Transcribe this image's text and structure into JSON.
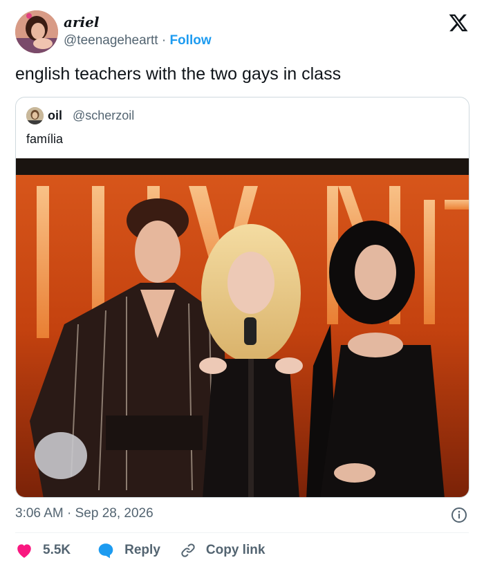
{
  "author": {
    "name": "ariel",
    "handle": "@teenageheartt",
    "separator": "·",
    "follow_label": "Follow"
  },
  "tweet": {
    "text": "english teachers with the two gays in class"
  },
  "quoted": {
    "name": "oil",
    "handle": "@scherzoil",
    "text": "família"
  },
  "meta": {
    "time": "3:06 AM",
    "separator": "·",
    "date": "Sep 28, 2026"
  },
  "actions": {
    "likes": "5.5K",
    "reply_label": "Reply",
    "copy_label": "Copy link"
  },
  "colors": {
    "like": "#f91880",
    "reply": "#1d9bf0",
    "link": "#1d9bf0",
    "muted": "#536471",
    "border": "#cfd9de"
  },
  "icons": [
    "x-logo-icon",
    "info-icon",
    "heart-icon",
    "reply-bubble-icon",
    "link-icon"
  ]
}
